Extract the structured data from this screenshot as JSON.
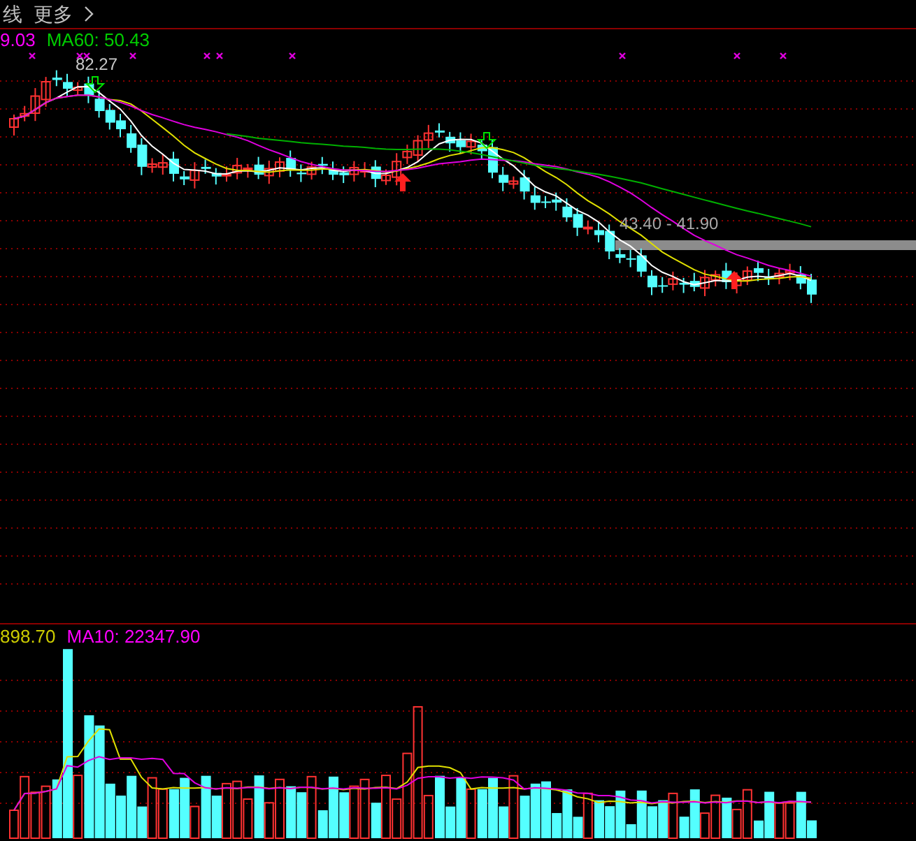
{
  "toolbar": {
    "items": [
      {
        "label": "线"
      },
      {
        "label": "更多"
      }
    ]
  },
  "price_panel": {
    "indicators": [
      {
        "text": "9.03",
        "color": "#ff00ff"
      },
      {
        "text": "MA60: 50.43",
        "color": "#00cc00"
      }
    ],
    "high_label": "82.27",
    "range_label": "43.40 - 41.90"
  },
  "volume_panel": {
    "indicators": [
      {
        "text": "898.70",
        "color": "#cccc00"
      },
      {
        "text": "MA10: 22347.90",
        "color": "#ff00ff"
      }
    ]
  }
}
